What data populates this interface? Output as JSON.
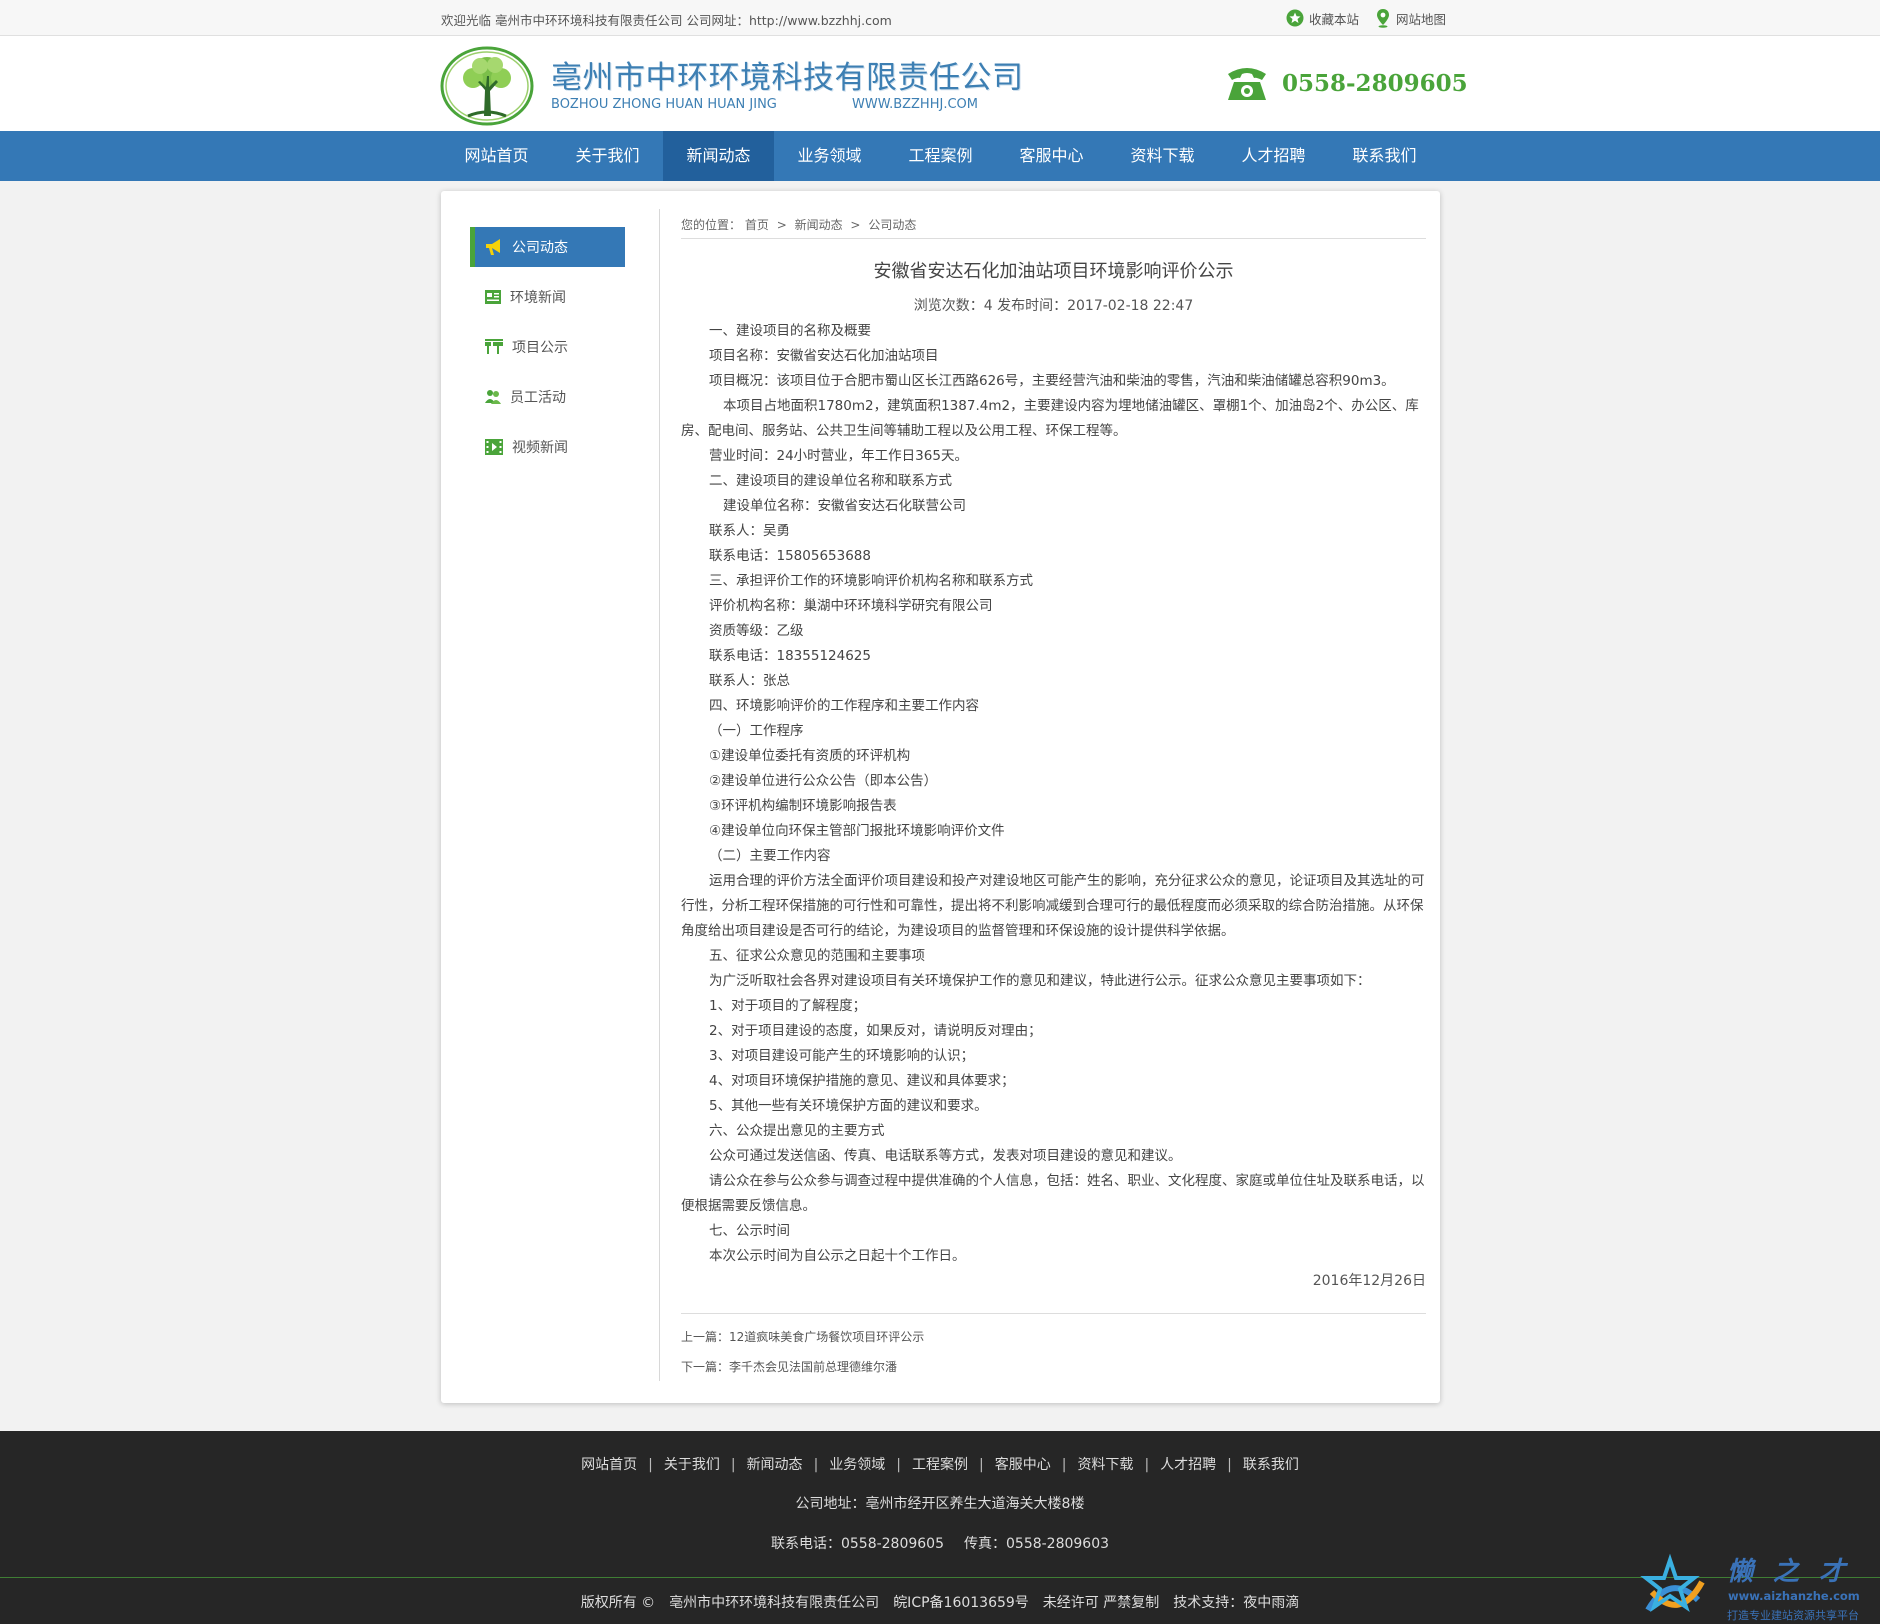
{
  "topbar": {
    "welcome": "欢迎光临 亳州市中环环境科技有限责任公司 公司网址：http://www.bzzhhj.com",
    "bookmark": "收藏本站",
    "sitemap": "网站地图"
  },
  "header": {
    "company_name": "亳州市中环环境科技有限责任公司",
    "pinyin": "BOZHOU ZHONG HUAN HUAN JING",
    "website": "WWW.BZZHHJ.COM",
    "phone": "0558-2809605"
  },
  "nav": {
    "items": [
      "网站首页",
      "关于我们",
      "新闻动态",
      "业务领域",
      "工程案例",
      "客服中心",
      "资料下载",
      "人才招聘",
      "联系我们"
    ]
  },
  "sidebar": {
    "items": [
      "公司动态",
      "环境新闻",
      "项目公示",
      "员工活动",
      "视频新闻"
    ]
  },
  "breadcrumb": {
    "label": "您的位置：",
    "home": "首页",
    "section": "新闻动态",
    "current": "公司动态",
    "separator": ">"
  },
  "article": {
    "title": "安徽省安达石化加油站项目环境影响评价公示",
    "meta": "浏览次数：4  发布时间：2017-02-18 22:47",
    "paragraphs": [
      "一、建设项目的名称及概要",
      "项目名称：安徽省安达石化加油站项目",
      "项目概况：该项目位于合肥市蜀山区长江西路626号，主要经营汽油和柴油的零售，汽油和柴油储罐总容积90m3。",
      "本项目占地面积1780m2，建筑面积1387.4m2，主要建设内容为埋地储油罐区、罩棚1个、加油岛2个、办公区、库房、配电间、服务站、公共卫生间等辅助工程以及公用工程、环保工程等。",
      "营业时间：24小时营业，年工作日365天。",
      "二、建设项目的建设单位名称和联系方式",
      "建设单位名称：安徽省安达石化联营公司",
      "联系人：吴勇",
      "联系电话：15805653688",
      "三、承担评价工作的环境影响评价机构名称和联系方式",
      "评价机构名称：巢湖中环环境科学研究有限公司",
      "资质等级：乙级",
      "联系电话：18355124625",
      "联系人：张总",
      "四、环境影响评价的工作程序和主要工作内容",
      "（一）工作程序",
      "①建设单位委托有资质的环评机构",
      "②建设单位进行公众公告（即本公告）",
      "③环评机构编制环境影响报告表",
      "④建设单位向环保主管部门报批环境影响评价文件",
      "（二）主要工作内容",
      "运用合理的评价方法全面评价项目建设和投产对建设地区可能产生的影响，充分征求公众的意见，论证项目及其选址的可行性，分析工程环保措施的可行性和可靠性，提出将不利影响减缓到合理可行的最低程度而必须采取的综合防治措施。从环保角度给出项目建设是否可行的结论，为建设项目的监督管理和环保设施的设计提供科学依据。",
      "五、征求公众意见的范围和主要事项",
      "为广泛听取社会各界对建设项目有关环境保护工作的意见和建议，特此进行公示。征求公众意见主要事项如下：",
      "1、对于项目的了解程度；",
      "2、对于项目建设的态度，如果反对，请说明反对理由；",
      "3、对项目建设可能产生的环境影响的认识；",
      "4、对项目环境保护措施的意见、建议和具体要求；",
      "5、其他一些有关环境保护方面的建议和要求。",
      "六、公众提出意见的主要方式",
      "公众可通过发送信函、传真、电话联系等方式，发表对项目建设的意见和建议。",
      "请公众在参与公众参与调查过程中提供准确的个人信息，包括：姓名、职业、文化程度、家庭或单位住址及联系电话，以便根据需要反馈信息。",
      "七、公示时间",
      "本次公示时间为自公示之日起十个工作日。"
    ],
    "date": "2016年12月26日",
    "prev": "上一篇：12道疯味美食广场餐饮项目环评公示",
    "next": "下一篇：李千杰会见法国前总理德维尔潘"
  },
  "footer": {
    "links": [
      "网站首页",
      "关于我们",
      "新闻动态",
      "业务领域",
      "工程案例",
      "客服中心",
      "资料下载",
      "人才招聘",
      "联系我们"
    ],
    "address": "公司地址：亳州市经开区养生大道海关大楼8楼",
    "phone": "联系电话：0558-2809605",
    "fax": "传真：0558-2809603",
    "copyright": "版权所有 ©",
    "company": "亳州市中环环境科技有限责任公司",
    "icp": "皖ICP备16013659号",
    "notice": "未经许可 严禁复制",
    "support": "技术支持：夜中雨滴"
  },
  "watermark": {
    "brand": "懒之才",
    "url": "www.aizhanzhe.com",
    "slogan": "打造专业建站资源共享平台"
  },
  "colors": {
    "nav_blue": "#3478b6",
    "nav_active": "#22609c",
    "accent_green": "#4aa43a",
    "footer_bg": "#262626"
  }
}
